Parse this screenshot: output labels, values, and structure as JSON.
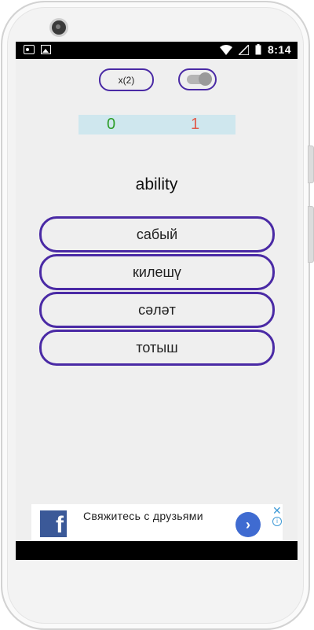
{
  "status_bar": {
    "time": "8:14",
    "left_icons": [
      "radio-icon",
      "image-icon"
    ],
    "right_icons": [
      "wifi-icon",
      "signal-icon",
      "battery-icon"
    ]
  },
  "controls": {
    "multiplier_label": "x(2)",
    "toggle_on": false
  },
  "score": {
    "correct": "0",
    "wrong": "1",
    "correct_color": "#2e9e2a",
    "wrong_color": "#e05a4a"
  },
  "question": {
    "word": "ability"
  },
  "answers": [
    {
      "label": "сабый"
    },
    {
      "label": "килешү"
    },
    {
      "label": "сәләт"
    },
    {
      "label": "тотыш"
    }
  ],
  "ad": {
    "logo_letter": "f",
    "text": "Свяжитесь с друзьями",
    "cta_icon": "chevron-right-icon",
    "close_icon": "close-icon",
    "info_icon": "info-icon"
  },
  "colors": {
    "accent": "#4a2aa5",
    "score_bg": "#cfe7ee",
    "facebook_blue": "#3b5998"
  }
}
